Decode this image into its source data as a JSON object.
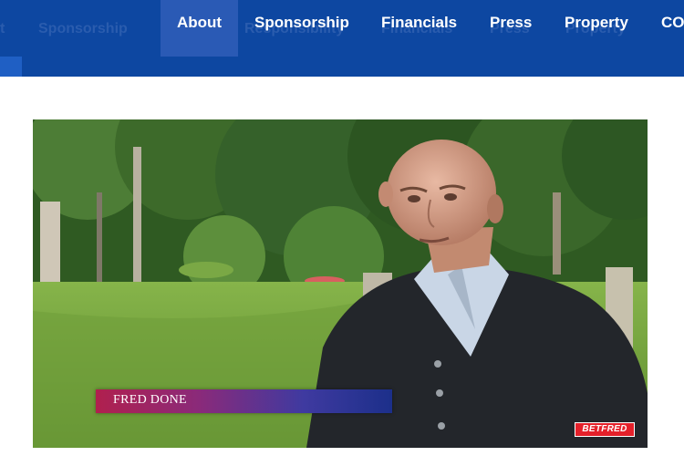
{
  "header": {
    "nav": [
      {
        "label": "About",
        "active": true
      },
      {
        "label": "Sponsorship",
        "active": false
      },
      {
        "label": "Financials",
        "active": false
      },
      {
        "label": "Press",
        "active": false
      },
      {
        "label": "Property",
        "active": false
      },
      {
        "label": "CO",
        "active": false
      }
    ],
    "ghost_nav": [
      "t",
      "Sponsorship",
      "Responsibility",
      "Financials",
      "Press",
      "Property"
    ]
  },
  "video": {
    "caption": "FRED DONE",
    "logo_text": "BETFRED"
  },
  "colors": {
    "header_bg": "#0d47a1",
    "nav_active_bg": "#2a5ab5",
    "logo_red": "#e4202a"
  }
}
